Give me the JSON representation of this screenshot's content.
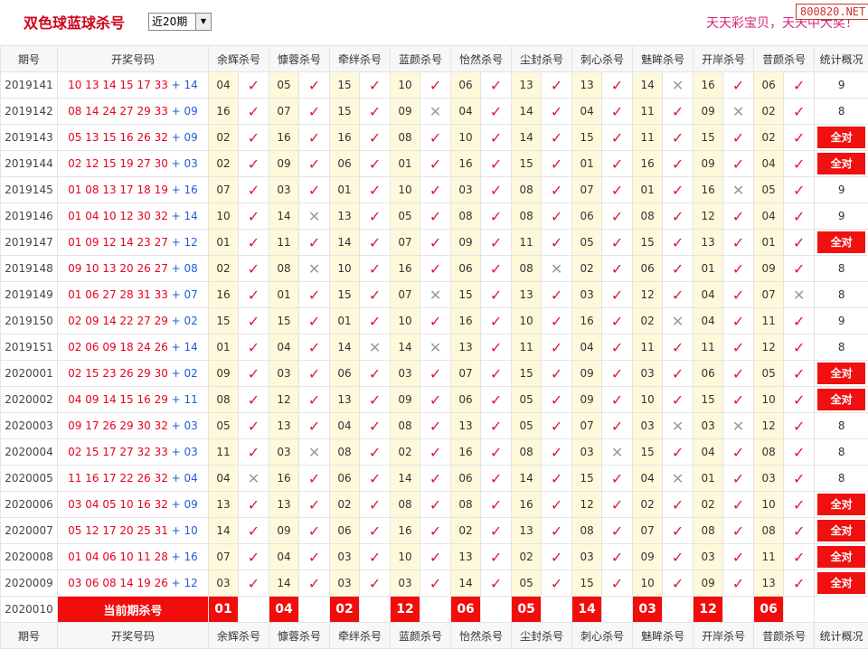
{
  "header": {
    "title": "双色球蓝球杀号",
    "range_select": "近20期",
    "slogan": "天天彩宝贝，天天中大奖！",
    "site_badge": "800820.NET"
  },
  "columns": [
    "期号",
    "开奖号码",
    "余辉杀号",
    "慷蓉杀号",
    "牵绊杀号",
    "蓝颜杀号",
    "怡然杀号",
    "尘封杀号",
    "刺心杀号",
    "魅眸杀号",
    "开岸杀号",
    "昔颜杀号",
    "统计概况"
  ],
  "rows": [
    {
      "period": "2019141",
      "reds": "10 13 14 15 17 33",
      "blue": "14",
      "kills": [
        [
          "04",
          1
        ],
        [
          "05",
          1
        ],
        [
          "15",
          1
        ],
        [
          "10",
          1
        ],
        [
          "06",
          1
        ],
        [
          "13",
          1
        ],
        [
          "13",
          1
        ],
        [
          "14",
          0
        ],
        [
          "16",
          1
        ],
        [
          "06",
          1
        ]
      ],
      "stat": "9"
    },
    {
      "period": "2019142",
      "reds": "08 14 24 27 29 33",
      "blue": "09",
      "kills": [
        [
          "16",
          1
        ],
        [
          "07",
          1
        ],
        [
          "15",
          1
        ],
        [
          "09",
          0
        ],
        [
          "04",
          1
        ],
        [
          "14",
          1
        ],
        [
          "04",
          1
        ],
        [
          "11",
          1
        ],
        [
          "09",
          0
        ],
        [
          "02",
          1
        ]
      ],
      "stat": "8"
    },
    {
      "period": "2019143",
      "reds": "05 13 15 16 26 32",
      "blue": "09",
      "kills": [
        [
          "02",
          1
        ],
        [
          "16",
          1
        ],
        [
          "16",
          1
        ],
        [
          "08",
          1
        ],
        [
          "10",
          1
        ],
        [
          "14",
          1
        ],
        [
          "15",
          1
        ],
        [
          "11",
          1
        ],
        [
          "15",
          1
        ],
        [
          "02",
          1
        ]
      ],
      "stat": "全对"
    },
    {
      "period": "2019144",
      "reds": "02 12 15 19 27 30",
      "blue": "03",
      "kills": [
        [
          "02",
          1
        ],
        [
          "09",
          1
        ],
        [
          "06",
          1
        ],
        [
          "01",
          1
        ],
        [
          "16",
          1
        ],
        [
          "15",
          1
        ],
        [
          "01",
          1
        ],
        [
          "16",
          1
        ],
        [
          "09",
          1
        ],
        [
          "04",
          1
        ]
      ],
      "stat": "全对"
    },
    {
      "period": "2019145",
      "reds": "01 08 13 17 18 19",
      "blue": "16",
      "kills": [
        [
          "07",
          1
        ],
        [
          "03",
          1
        ],
        [
          "01",
          1
        ],
        [
          "10",
          1
        ],
        [
          "03",
          1
        ],
        [
          "08",
          1
        ],
        [
          "07",
          1
        ],
        [
          "01",
          1
        ],
        [
          "16",
          0
        ],
        [
          "05",
          1
        ]
      ],
      "stat": "9"
    },
    {
      "period": "2019146",
      "reds": "01 04 10 12 30 32",
      "blue": "14",
      "kills": [
        [
          "10",
          1
        ],
        [
          "14",
          0
        ],
        [
          "13",
          1
        ],
        [
          "05",
          1
        ],
        [
          "08",
          1
        ],
        [
          "08",
          1
        ],
        [
          "06",
          1
        ],
        [
          "08",
          1
        ],
        [
          "12",
          1
        ],
        [
          "04",
          1
        ]
      ],
      "stat": "9"
    },
    {
      "period": "2019147",
      "reds": "01 09 12 14 23 27",
      "blue": "12",
      "kills": [
        [
          "01",
          1
        ],
        [
          "11",
          1
        ],
        [
          "14",
          1
        ],
        [
          "07",
          1
        ],
        [
          "09",
          1
        ],
        [
          "11",
          1
        ],
        [
          "05",
          1
        ],
        [
          "15",
          1
        ],
        [
          "13",
          1
        ],
        [
          "01",
          1
        ]
      ],
      "stat": "全对"
    },
    {
      "period": "2019148",
      "reds": "09 10 13 20 26 27",
      "blue": "08",
      "kills": [
        [
          "02",
          1
        ],
        [
          "08",
          0
        ],
        [
          "10",
          1
        ],
        [
          "16",
          1
        ],
        [
          "06",
          1
        ],
        [
          "08",
          0
        ],
        [
          "02",
          1
        ],
        [
          "06",
          1
        ],
        [
          "01",
          1
        ],
        [
          "09",
          1
        ]
      ],
      "stat": "8"
    },
    {
      "period": "2019149",
      "reds": "01 06 27 28 31 33",
      "blue": "07",
      "kills": [
        [
          "16",
          1
        ],
        [
          "01",
          1
        ],
        [
          "15",
          1
        ],
        [
          "07",
          0
        ],
        [
          "15",
          1
        ],
        [
          "13",
          1
        ],
        [
          "03",
          1
        ],
        [
          "12",
          1
        ],
        [
          "04",
          1
        ],
        [
          "07",
          0
        ]
      ],
      "stat": "8"
    },
    {
      "period": "2019150",
      "reds": "02 09 14 22 27 29",
      "blue": "02",
      "kills": [
        [
          "15",
          1
        ],
        [
          "15",
          1
        ],
        [
          "01",
          1
        ],
        [
          "10",
          1
        ],
        [
          "16",
          1
        ],
        [
          "10",
          1
        ],
        [
          "16",
          1
        ],
        [
          "02",
          0
        ],
        [
          "04",
          1
        ],
        [
          "11",
          1
        ]
      ],
      "stat": "9"
    },
    {
      "period": "2019151",
      "reds": "02 06 09 18 24 26",
      "blue": "14",
      "kills": [
        [
          "01",
          1
        ],
        [
          "04",
          1
        ],
        [
          "14",
          0
        ],
        [
          "14",
          0
        ],
        [
          "13",
          1
        ],
        [
          "11",
          1
        ],
        [
          "04",
          1
        ],
        [
          "11",
          1
        ],
        [
          "11",
          1
        ],
        [
          "12",
          1
        ]
      ],
      "stat": "8"
    },
    {
      "period": "2020001",
      "reds": "02 15 23 26 29 30",
      "blue": "02",
      "kills": [
        [
          "09",
          1
        ],
        [
          "03",
          1
        ],
        [
          "06",
          1
        ],
        [
          "03",
          1
        ],
        [
          "07",
          1
        ],
        [
          "15",
          1
        ],
        [
          "09",
          1
        ],
        [
          "03",
          1
        ],
        [
          "06",
          1
        ],
        [
          "05",
          1
        ]
      ],
      "stat": "全对"
    },
    {
      "period": "2020002",
      "reds": "04 09 14 15 16 29",
      "blue": "11",
      "kills": [
        [
          "08",
          1
        ],
        [
          "12",
          1
        ],
        [
          "13",
          1
        ],
        [
          "09",
          1
        ],
        [
          "06",
          1
        ],
        [
          "05",
          1
        ],
        [
          "09",
          1
        ],
        [
          "10",
          1
        ],
        [
          "15",
          1
        ],
        [
          "10",
          1
        ]
      ],
      "stat": "全对"
    },
    {
      "period": "2020003",
      "reds": "09 17 26 29 30 32",
      "blue": "03",
      "kills": [
        [
          "05",
          1
        ],
        [
          "13",
          1
        ],
        [
          "04",
          1
        ],
        [
          "08",
          1
        ],
        [
          "13",
          1
        ],
        [
          "05",
          1
        ],
        [
          "07",
          1
        ],
        [
          "03",
          0
        ],
        [
          "03",
          0
        ],
        [
          "12",
          1
        ]
      ],
      "stat": "8"
    },
    {
      "period": "2020004",
      "reds": "02 15 17 27 32 33",
      "blue": "03",
      "kills": [
        [
          "11",
          1
        ],
        [
          "03",
          0
        ],
        [
          "08",
          1
        ],
        [
          "02",
          1
        ],
        [
          "16",
          1
        ],
        [
          "08",
          1
        ],
        [
          "03",
          0
        ],
        [
          "15",
          1
        ],
        [
          "04",
          1
        ],
        [
          "08",
          1
        ]
      ],
      "stat": "8"
    },
    {
      "period": "2020005",
      "reds": "11 16 17 22 26 32",
      "blue": "04",
      "kills": [
        [
          "04",
          0
        ],
        [
          "16",
          1
        ],
        [
          "06",
          1
        ],
        [
          "14",
          1
        ],
        [
          "06",
          1
        ],
        [
          "14",
          1
        ],
        [
          "15",
          1
        ],
        [
          "04",
          0
        ],
        [
          "01",
          1
        ],
        [
          "03",
          1
        ]
      ],
      "stat": "8"
    },
    {
      "period": "2020006",
      "reds": "03 04 05 10 16 32",
      "blue": "09",
      "kills": [
        [
          "13",
          1
        ],
        [
          "13",
          1
        ],
        [
          "02",
          1
        ],
        [
          "08",
          1
        ],
        [
          "08",
          1
        ],
        [
          "16",
          1
        ],
        [
          "12",
          1
        ],
        [
          "02",
          1
        ],
        [
          "02",
          1
        ],
        [
          "10",
          1
        ]
      ],
      "stat": "全对"
    },
    {
      "period": "2020007",
      "reds": "05 12 17 20 25 31",
      "blue": "10",
      "kills": [
        [
          "14",
          1
        ],
        [
          "09",
          1
        ],
        [
          "06",
          1
        ],
        [
          "16",
          1
        ],
        [
          "02",
          1
        ],
        [
          "13",
          1
        ],
        [
          "08",
          1
        ],
        [
          "07",
          1
        ],
        [
          "08",
          1
        ],
        [
          "08",
          1
        ]
      ],
      "stat": "全对"
    },
    {
      "period": "2020008",
      "reds": "01 04 06 10 11 28",
      "blue": "16",
      "kills": [
        [
          "07",
          1
        ],
        [
          "04",
          1
        ],
        [
          "03",
          1
        ],
        [
          "10",
          1
        ],
        [
          "13",
          1
        ],
        [
          "02",
          1
        ],
        [
          "03",
          1
        ],
        [
          "09",
          1
        ],
        [
          "03",
          1
        ],
        [
          "11",
          1
        ]
      ],
      "stat": "全对"
    },
    {
      "period": "2020009",
      "reds": "03 06 08 14 19 26",
      "blue": "12",
      "kills": [
        [
          "03",
          1
        ],
        [
          "14",
          1
        ],
        [
          "03",
          1
        ],
        [
          "03",
          1
        ],
        [
          "14",
          1
        ],
        [
          "05",
          1
        ],
        [
          "15",
          1
        ],
        [
          "10",
          1
        ],
        [
          "09",
          1
        ],
        [
          "13",
          1
        ]
      ],
      "stat": "全对"
    }
  ],
  "current": {
    "period": "2020010",
    "label": "当前期杀号",
    "kills": [
      "01",
      "04",
      "02",
      "12",
      "06",
      "05",
      "14",
      "03",
      "12",
      "06"
    ]
  },
  "colors": {
    "hit": "#e0172f",
    "miss": "#9a9a9a",
    "badge": "#f01010",
    "cellbg": "#fff9dc"
  },
  "icons": {
    "hit": "checkmark-icon",
    "miss": "cross-icon"
  }
}
